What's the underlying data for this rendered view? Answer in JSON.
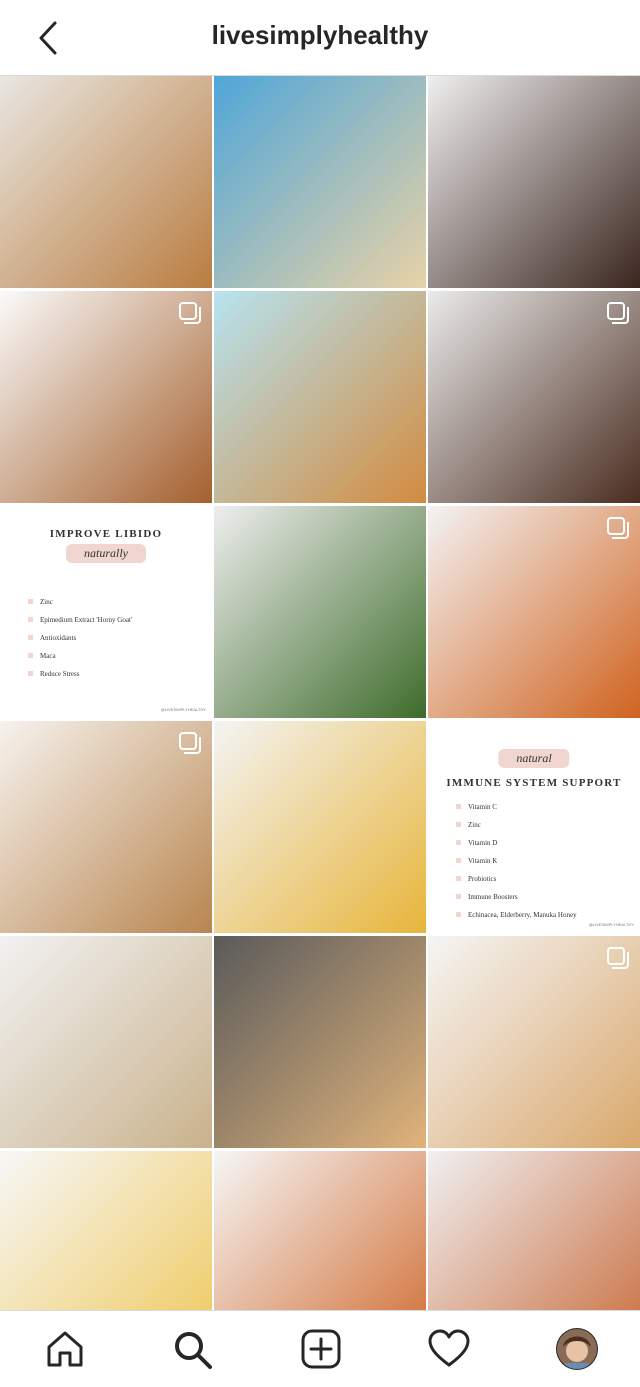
{
  "header": {
    "title": "livesimplyhealthy",
    "back_icon": "chevron-left-icon"
  },
  "posts": [
    {
      "id": "muffin",
      "colors": [
        "#e9e6e2",
        "#b97d3f"
      ],
      "multi": false
    },
    {
      "id": "beach",
      "colors": [
        "#4fa6d9",
        "#e8d2a6"
      ],
      "multi": false
    },
    {
      "id": "choc-eggs-1",
      "colors": [
        "#efefef",
        "#3a251e"
      ],
      "multi": false
    },
    {
      "id": "carrot-cake",
      "colors": [
        "#fafafa",
        "#a4602d"
      ],
      "multi": true
    },
    {
      "id": "penne",
      "colors": [
        "#b7e3f0",
        "#d28b3f"
      ],
      "multi": false
    },
    {
      "id": "choc-eggs-2",
      "colors": [
        "#eaeaea",
        "#4a2d20"
      ],
      "multi": true
    },
    {
      "id": "info-libido",
      "colors": [
        "#ffffff",
        "#f1d6cf"
      ],
      "multi": false,
      "info": {
        "title": "IMPROVE LIBIDO",
        "subtitle": "naturally",
        "items": [
          "Zinc",
          "Epimedium Extract 'Horny Goat'",
          "Antioxidants",
          "Maca",
          "Reduce Stress"
        ],
        "handle": "@LIVESIMPLYHEALTHY"
      }
    },
    {
      "id": "salad-bowl",
      "colors": [
        "#eeeeee",
        "#3e6c2b"
      ],
      "multi": false
    },
    {
      "id": "chickpea-curry",
      "colors": [
        "#f3f3f3",
        "#d0631f"
      ],
      "multi": true
    },
    {
      "id": "cookies",
      "colors": [
        "#f7f3ee",
        "#b8854f"
      ],
      "multi": true
    },
    {
      "id": "noodles",
      "colors": [
        "#f4f4f4",
        "#e7b53a"
      ],
      "multi": false
    },
    {
      "id": "info-immune",
      "colors": [
        "#ffffff",
        "#f1d6cf"
      ],
      "multi": false,
      "info": {
        "title": "IMMUNE SYSTEM SUPPORT",
        "subtitle": "natural",
        "items": [
          "Vitamin C",
          "Zinc",
          "Vitamin D",
          "Vitamin K",
          "Probiotics",
          "Immune Boosters",
          "Echinacea, Elderberry, Manuka Honey"
        ],
        "handle": "@LIVESIMPLYHEALTHY"
      }
    },
    {
      "id": "rice-bowl",
      "colors": [
        "#f2f2f2",
        "#c9b28c"
      ],
      "multi": false
    },
    {
      "id": "fries",
      "colors": [
        "#5a5a5a",
        "#e0b37b"
      ],
      "multi": false
    },
    {
      "id": "cake-slice",
      "colors": [
        "#f5f5f5",
        "#d9a86c"
      ],
      "multi": true
    },
    {
      "id": "snack-plate",
      "colors": [
        "#f7f7f7",
        "#efc85a"
      ],
      "multi": false
    },
    {
      "id": "penne-2",
      "colors": [
        "#f6f6f6",
        "#cf6a2e"
      ],
      "multi": false
    },
    {
      "id": "pancakes",
      "colors": [
        "#f0f0f0",
        "#c86b3a"
      ],
      "multi": false
    },
    {
      "id": "partial-1",
      "colors": [
        "#ededed",
        "#d8cfc6"
      ],
      "multi": false
    },
    {
      "id": "partial-2",
      "colors": [
        "#ededed",
        "#d7b9a6"
      ],
      "multi": false
    },
    {
      "id": "partial-3",
      "colors": [
        "#ededed",
        "#c9c6c3"
      ],
      "multi": false
    }
  ],
  "nav": {
    "items": [
      {
        "id": "home",
        "icon": "home-icon"
      },
      {
        "id": "search",
        "icon": "search-icon"
      },
      {
        "id": "new-post",
        "icon": "plus-square-icon"
      },
      {
        "id": "activity",
        "icon": "heart-icon"
      },
      {
        "id": "profile",
        "icon": "avatar"
      }
    ]
  }
}
